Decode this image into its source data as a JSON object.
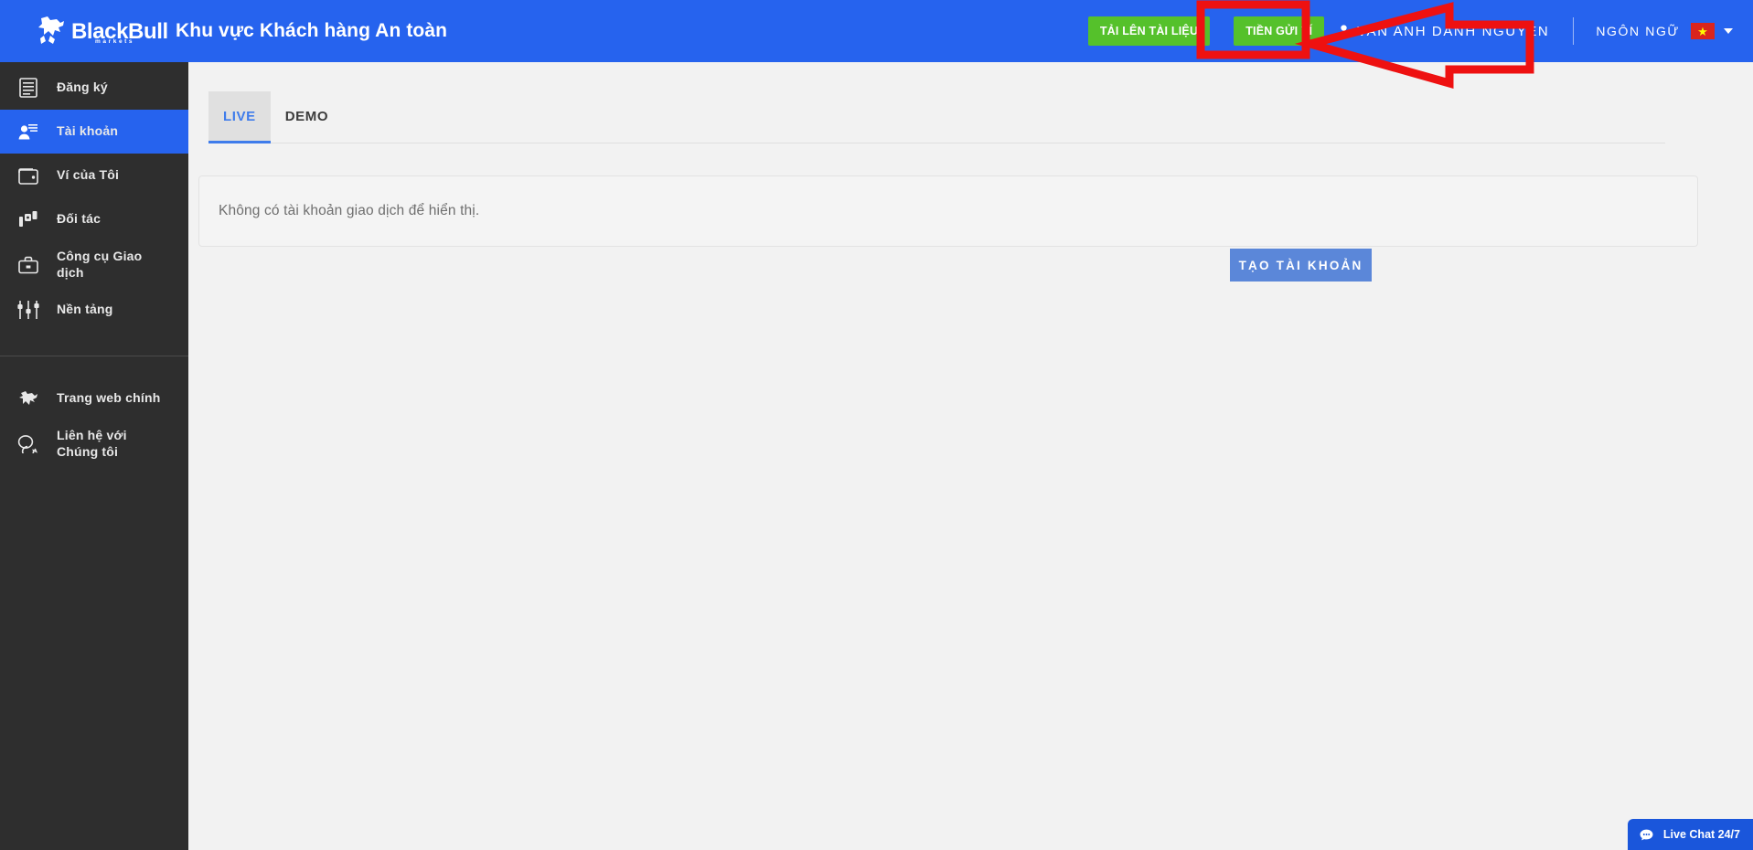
{
  "header": {
    "brand_name": "BlackBull",
    "brand_sub": "markets",
    "title": "Khu vực Khách hàng An toàn",
    "upload_documents_label": "TẢI LÊN TÀI LIỆU",
    "wallet_deposit_label": "TIỀN GỬI VÍ",
    "user_name": "VAN ANH DANH NGUYEN",
    "language_label": "NGÔN NGỮ",
    "language_flag": "vietnam-flag",
    "accent_blue": "#2663ee",
    "green_button_color": "#55c12b"
  },
  "sidebar": {
    "items": [
      {
        "label": "Đăng ký",
        "icon": "document-list-icon",
        "active": false
      },
      {
        "label": "Tài khoản",
        "icon": "account-user-icon",
        "active": true
      },
      {
        "label": "Ví của Tôi",
        "icon": "wallet-icon",
        "active": false
      },
      {
        "label": "Đối tác",
        "icon": "partners-icon",
        "active": false
      },
      {
        "label": "Công cụ Giao dịch",
        "icon": "briefcase-icon",
        "active": false
      },
      {
        "label": "Nền tảng",
        "icon": "sliders-icon",
        "active": false
      }
    ],
    "bottom_items": [
      {
        "label": "Trang web chính",
        "icon": "bull-icon"
      },
      {
        "label": "Liên hệ với Chúng tôi",
        "icon": "chat-bubbles-icon"
      }
    ]
  },
  "main": {
    "tabs": [
      {
        "label": "LIVE",
        "active": true
      },
      {
        "label": "DEMO",
        "active": false
      }
    ],
    "create_account_label": "TẠO TÀI KHOẢN",
    "empty_state_text": "Không có tài khoản giao dịch để hiển thị.",
    "active_tab_color": "#3f7ceb",
    "create_button_color": "#5b87d9"
  },
  "live_chat": {
    "label": "Live Chat 24/7",
    "icon": "chat-bubble-icon",
    "color": "#1a56db"
  },
  "annotation": {
    "color": "#ee1111",
    "highlight_target": "wallet-deposit-button",
    "shape": "rectangle-with-left-arrow"
  }
}
